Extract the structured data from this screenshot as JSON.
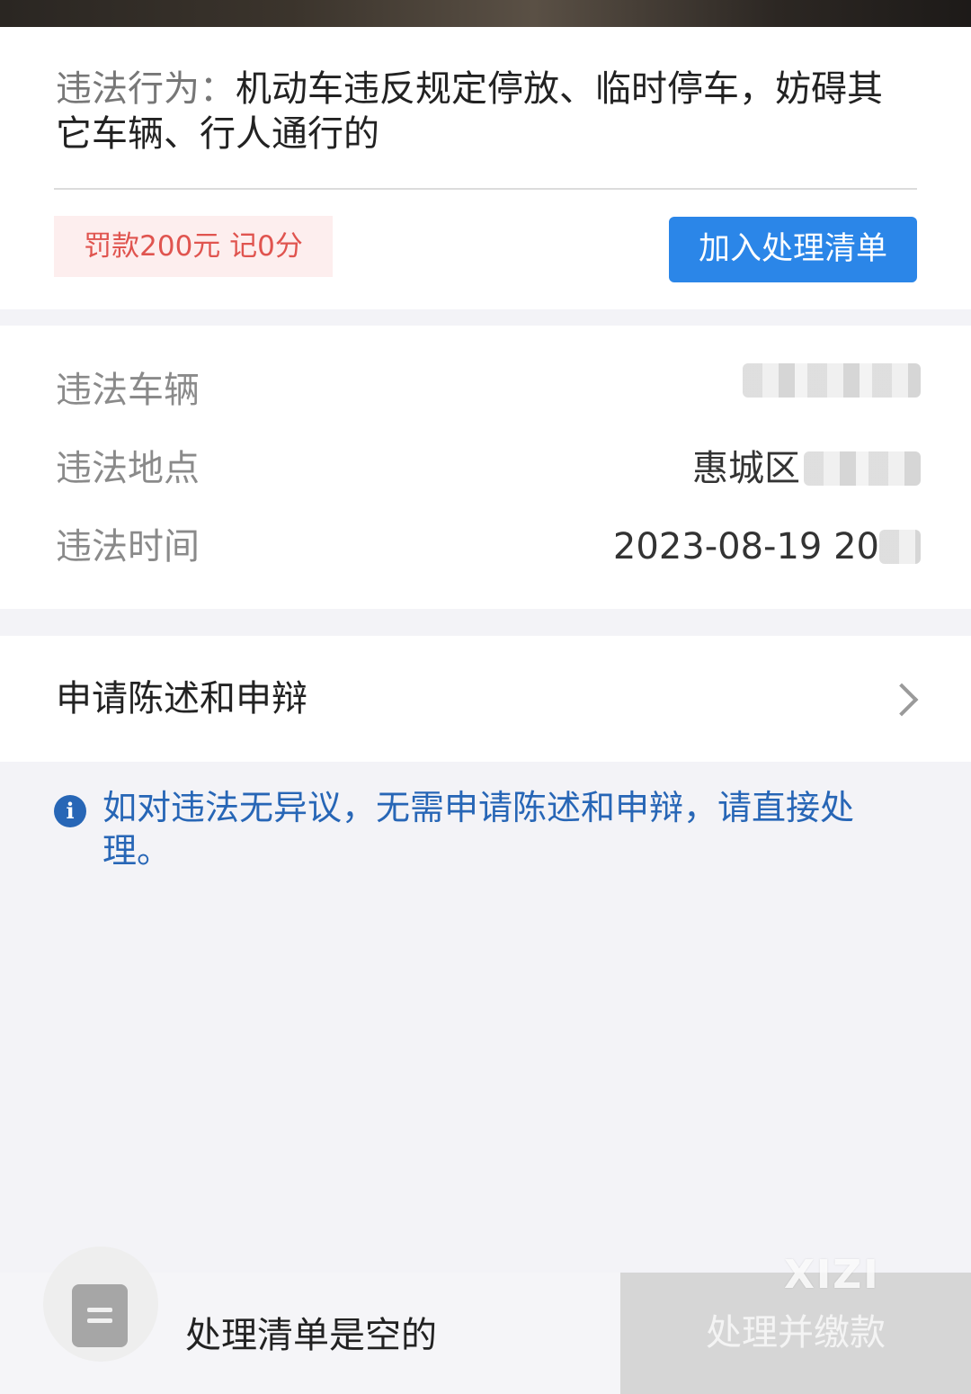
{
  "violation": {
    "behavior_label": "违法行为：",
    "behavior_text": "机动车违反规定停放、临时停车，妨碍其它车辆、行人通行的",
    "fine_badge": "罚款200元 记0分",
    "add_button_label": "加入处理清单"
  },
  "details": {
    "rows": [
      {
        "label": "违法车辆",
        "value": ""
      },
      {
        "label": "违法地点",
        "value": "惠城区"
      },
      {
        "label": "违法时间",
        "value": "2023-08-19 20"
      }
    ]
  },
  "appeal": {
    "label": "申请陈述和申辩"
  },
  "notice": {
    "icon": "info-icon",
    "text": "如对违法无异议，无需申请陈述和申辩，请直接处理。"
  },
  "bottom_bar": {
    "cart_icon": "list-icon",
    "empty_text": "处理清单是空的",
    "pay_button_label": "处理并缴款",
    "watermark": "XIZI"
  },
  "colors": {
    "primary": "#2b86e8",
    "notice": "#2766b6",
    "fine_text": "#e0544f",
    "fine_bg": "#fdeeee"
  }
}
